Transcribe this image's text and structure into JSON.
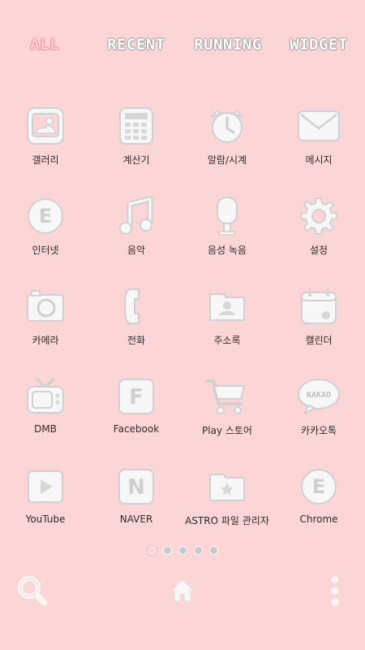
{
  "tabs": [
    {
      "label": "ALL",
      "active": true
    },
    {
      "label": "RECENT",
      "active": false
    },
    {
      "label": "RUNNING",
      "active": false
    },
    {
      "label": "WIDGET",
      "active": false
    }
  ],
  "apps": [
    {
      "label": "갤러리",
      "icon": "gallery-icon"
    },
    {
      "label": "계산기",
      "icon": "calculator-icon"
    },
    {
      "label": "알람/시계",
      "icon": "alarm-clock-icon"
    },
    {
      "label": "메시지",
      "icon": "message-icon"
    },
    {
      "label": "인터넷",
      "icon": "internet-icon",
      "glyph": "E"
    },
    {
      "label": "음악",
      "icon": "music-icon"
    },
    {
      "label": "음성 녹음",
      "icon": "voice-recorder-icon"
    },
    {
      "label": "설정",
      "icon": "settings-icon"
    },
    {
      "label": "카메라",
      "icon": "camera-icon"
    },
    {
      "label": "전화",
      "icon": "phone-icon"
    },
    {
      "label": "주소록",
      "icon": "contacts-icon"
    },
    {
      "label": "캘린더",
      "icon": "calendar-icon"
    },
    {
      "label": "DMB",
      "icon": "tv-icon"
    },
    {
      "label": "Facebook",
      "icon": "facebook-icon",
      "glyph": "F"
    },
    {
      "label": "Play 스토어",
      "icon": "shopping-cart-icon"
    },
    {
      "label": "카카오톡",
      "icon": "kakao-icon",
      "glyph": "KAKAO"
    },
    {
      "label": "YouTube",
      "icon": "youtube-icon"
    },
    {
      "label": "NAVER",
      "icon": "naver-icon",
      "glyph": "N"
    },
    {
      "label": "ASTRO 파일 관리자",
      "icon": "file-manager-icon"
    },
    {
      "label": "Chrome",
      "icon": "chrome-icon",
      "glyph": "E"
    }
  ],
  "pages": {
    "count": 5,
    "current": 0
  },
  "colors": {
    "background": "#fcd5d7",
    "icon_fill": "#f7f7f7",
    "icon_stroke": "#d0d0d0",
    "active_tab": "#ff86a0"
  },
  "bottom_bar": {
    "left_icon": "search-icon",
    "center_icon": "home-icon",
    "right_icon": "more-vertical-icon"
  }
}
